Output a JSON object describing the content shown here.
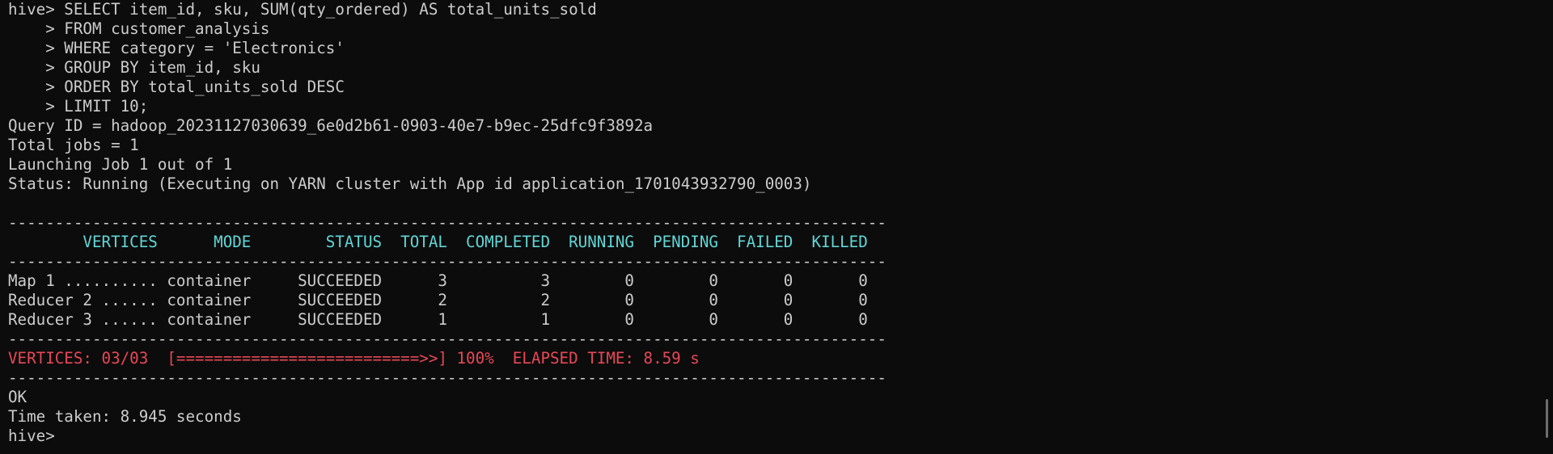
{
  "terminal": {
    "lines": [
      {
        "text": "hive> SELECT item_id, sku, SUM(qty_ordered) AS total_units_sold",
        "tone": "normal"
      },
      {
        "text": "    > FROM customer_analysis",
        "tone": "normal"
      },
      {
        "text": "    > WHERE category = 'Electronics'",
        "tone": "normal"
      },
      {
        "text": "    > GROUP BY item_id, sku",
        "tone": "normal"
      },
      {
        "text": "    > ORDER BY total_units_sold DESC",
        "tone": "normal"
      },
      {
        "text": "    > LIMIT 10;",
        "tone": "normal"
      },
      {
        "text": "Query ID = hadoop_20231127030639_6e0d2b61-0903-40e7-b9ec-25dfc9f3892a",
        "tone": "normal"
      },
      {
        "text": "Total jobs = 1",
        "tone": "normal"
      },
      {
        "text": "Launching Job 1 out of 1",
        "tone": "normal"
      },
      {
        "text": "Status: Running (Executing on YARN cluster with App id application_1701043932790_0003)",
        "tone": "normal"
      },
      {
        "text": "",
        "tone": "normal"
      },
      {
        "text": "----------------------------------------------------------------------------------------------",
        "tone": "normal"
      },
      {
        "text": "        VERTICES      MODE        STATUS  TOTAL  COMPLETED  RUNNING  PENDING  FAILED  KILLED",
        "tone": "cyan"
      },
      {
        "text": "----------------------------------------------------------------------------------------------",
        "tone": "normal"
      },
      {
        "text": "Map 1 .......... container     SUCCEEDED      3          3        0        0       0       0",
        "tone": "normal"
      },
      {
        "text": "Reducer 2 ...... container     SUCCEEDED      2          2        0        0       0       0",
        "tone": "normal"
      },
      {
        "text": "Reducer 3 ...... container     SUCCEEDED      1          1        0        0       0       0",
        "tone": "normal"
      },
      {
        "text": "----------------------------------------------------------------------------------------------",
        "tone": "normal"
      },
      {
        "text": "VERTICES: 03/03  [==========================>>] 100%  ELAPSED TIME: 8.59 s",
        "tone": "red"
      },
      {
        "text": "----------------------------------------------------------------------------------------------",
        "tone": "normal"
      },
      {
        "text": "OK",
        "tone": "normal"
      },
      {
        "text": "Time taken: 8.945 seconds",
        "tone": "normal"
      },
      {
        "text": "hive>",
        "tone": "normal"
      }
    ]
  },
  "colors": {
    "background": "#0c0c0c",
    "foreground": "#cccccc",
    "header_cyan": "#61d6d6",
    "progress_red": "#e74856"
  }
}
